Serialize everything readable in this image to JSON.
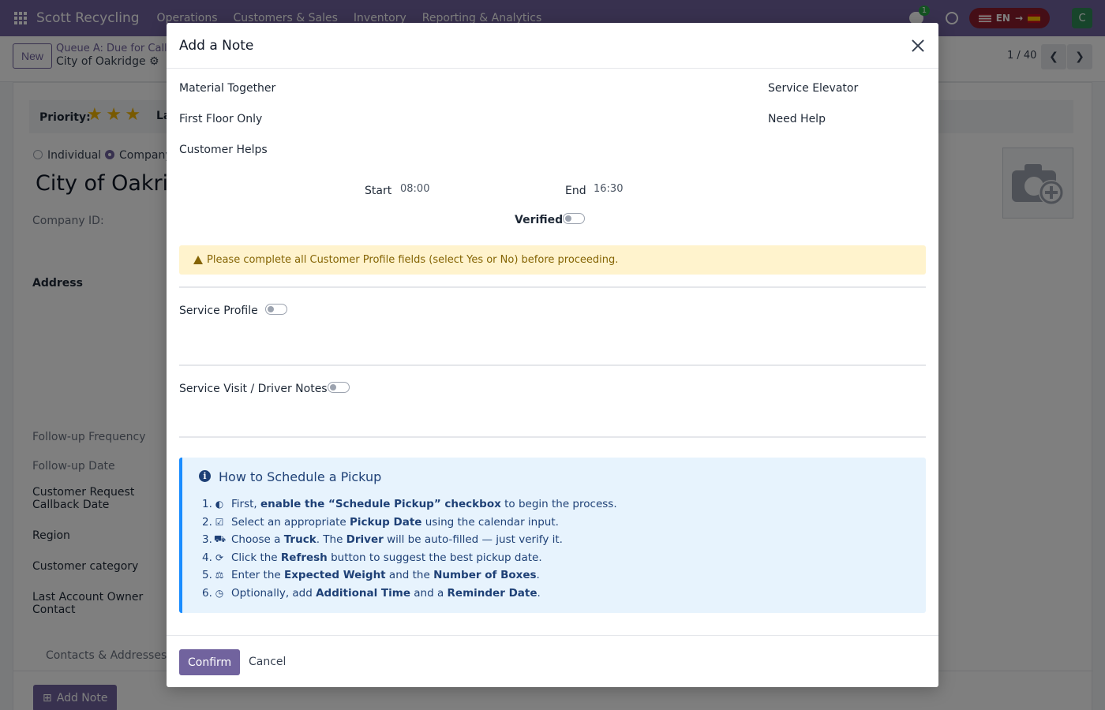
{
  "app": {
    "brand": "Scott Recycling",
    "menu": [
      "Operations",
      "Customers & Sales",
      "Inventory",
      "Reporting & Analytics"
    ],
    "chat_badge": "1",
    "lang_code": "EN",
    "avatar_letter": "C"
  },
  "controlbar": {
    "new_label": "New",
    "breadcrumb_queue": "Queue A: Due for Call",
    "breadcrumb_record": "City of Oakridge",
    "pager": "1 / 40"
  },
  "form": {
    "priority_label": "Priority:",
    "priority_stars": 3,
    "priority_max": 3,
    "partial_label": "La",
    "radio_individual": "Individual",
    "radio_company": "Company",
    "company_name": "City of Oakric",
    "company_id_label": "Company ID:",
    "address_label": "Address",
    "followup_frequency": "Follow-up Frequency",
    "followup_date": "Follow-up Date",
    "callback_date_l1": "Customer Request",
    "callback_date_l2": "Callback Date",
    "region": "Region",
    "customer_category": "Customer category",
    "last_owner_l1": "Last Account Owner",
    "last_owner_l2": "Contact",
    "tab_contacts": "Contacts & Addresses",
    "add_note_label": "Add Note"
  },
  "modal": {
    "title": "Add a Note",
    "material_together": "Material Together",
    "service_elevator": "Service Elevator",
    "first_floor_only": "First Floor Only",
    "need_help": "Need Help",
    "customer_helps": "Customer Helps",
    "start_label": "Start",
    "start_value": "08:00",
    "end_label": "End",
    "end_value": "16:30",
    "verified_label": "Verified",
    "warning": "Please complete all Customer Profile fields (select Yes or No) before proceeding.",
    "service_profile": "Service Profile",
    "service_visit": "Service Visit / Driver Notes",
    "info_title": "How to Schedule a Pickup",
    "steps": [
      {
        "num": "1.",
        "icon": "toggle-icon",
        "glyph": "◐",
        "pre": "First, ",
        "b1": "enable the “Schedule Pickup” checkbox",
        "mid": " to begin the process.",
        "b2": "",
        "post": ""
      },
      {
        "num": "2.",
        "icon": "calendar-check-icon",
        "glyph": "☑",
        "pre": "Select an appropriate ",
        "b1": "Pickup Date",
        "mid": " using the calendar input.",
        "b2": "",
        "post": ""
      },
      {
        "num": "3.",
        "icon": "truck-icon",
        "glyph": "⛟",
        "pre": "Choose a ",
        "b1": "Truck",
        "mid": ". The ",
        "b2": "Driver",
        "post": " will be auto-filled — just verify it."
      },
      {
        "num": "4.",
        "icon": "refresh-icon",
        "glyph": "⟳",
        "pre": "Click the ",
        "b1": "Refresh",
        "mid": " button to suggest the best pickup date.",
        "b2": "",
        "post": ""
      },
      {
        "num": "5.",
        "icon": "scale-icon",
        "glyph": "⚖",
        "pre": "Enter the ",
        "b1": "Expected Weight",
        "mid": " and the ",
        "b2": "Number of Boxes",
        "post": "."
      },
      {
        "num": "6.",
        "icon": "clock-icon",
        "glyph": "◷",
        "pre": "Optionally, add ",
        "b1": "Additional Time",
        "mid": " and a ",
        "b2": "Reminder Date",
        "post": "."
      }
    ],
    "confirm_label": "Confirm",
    "cancel_label": "Cancel"
  },
  "colors": {
    "brand": "#71639e",
    "warning_bg": "#fff3cd",
    "info_bg": "#e7f3fd",
    "info_accent": "#1a8cff"
  }
}
